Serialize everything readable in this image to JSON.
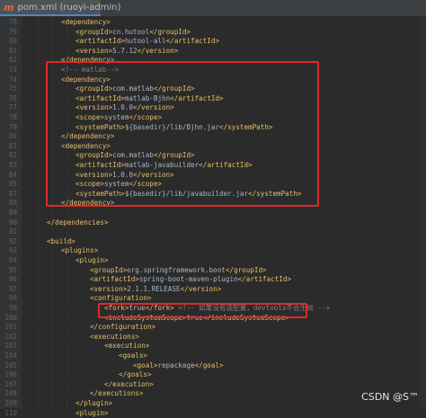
{
  "tab": {
    "icon": "m",
    "label": "pom.xml (ruoyi-admin)"
  },
  "colors": {
    "tag": "#e8bf6a",
    "comment": "#808080",
    "text": "#a9b7c6",
    "highlight": "#e02a2a"
  },
  "lines": [
    {
      "n": "78",
      "indent": 2,
      "parts": [
        [
          "t",
          "<dependency>"
        ]
      ]
    },
    {
      "n": "79",
      "indent": 3,
      "parts": [
        [
          "t",
          "<groupId>"
        ],
        [
          "x",
          "cn.hutool"
        ],
        [
          "t",
          "</groupId>"
        ]
      ]
    },
    {
      "n": "80",
      "indent": 3,
      "parts": [
        [
          "t",
          "<artifactId>"
        ],
        [
          "x",
          "hutool-all"
        ],
        [
          "t",
          "</artifactId>"
        ]
      ]
    },
    {
      "n": "81",
      "indent": 3,
      "parts": [
        [
          "t",
          "<version>"
        ],
        [
          "x",
          "5.7.12"
        ],
        [
          "t",
          "</version>"
        ]
      ]
    },
    {
      "n": "82",
      "indent": 2,
      "parts": [
        [
          "t",
          "</dependency>"
        ]
      ]
    },
    {
      "n": "73",
      "indent": 2,
      "parts": [
        [
          "c",
          "<!-- matlab-->"
        ]
      ]
    },
    {
      "n": "74",
      "indent": 2,
      "parts": [
        [
          "t",
          "<dependency>"
        ]
      ]
    },
    {
      "n": "75",
      "indent": 3,
      "parts": [
        [
          "t",
          "<groupId>"
        ],
        [
          "x",
          "com.matlab"
        ],
        [
          "t",
          "</groupId>"
        ]
      ]
    },
    {
      "n": "76",
      "indent": 3,
      "parts": [
        [
          "t",
          "<artifactId>"
        ],
        [
          "x",
          "matlab-Bjhn"
        ],
        [
          "t",
          "</artifactId>"
        ]
      ]
    },
    {
      "n": "77",
      "indent": 3,
      "parts": [
        [
          "t",
          "<version>"
        ],
        [
          "x",
          "1.0.0"
        ],
        [
          "t",
          "</version>"
        ]
      ]
    },
    {
      "n": "78",
      "indent": 3,
      "parts": [
        [
          "t",
          "<scope>"
        ],
        [
          "x",
          "system"
        ],
        [
          "t",
          "</scope>"
        ]
      ]
    },
    {
      "n": "79",
      "indent": 3,
      "parts": [
        [
          "t",
          "<systemPath>"
        ],
        [
          "x",
          "${basedir}/lib/Bjhn.jar"
        ],
        [
          "t",
          "</systemPath>"
        ]
      ]
    },
    {
      "n": "80",
      "indent": 2,
      "parts": [
        [
          "t",
          "</dependency>"
        ]
      ]
    },
    {
      "n": "81",
      "indent": 2,
      "parts": [
        [
          "t",
          "<dependency>"
        ]
      ]
    },
    {
      "n": "82",
      "indent": 3,
      "parts": [
        [
          "t",
          "<groupId>"
        ],
        [
          "x",
          "com.matlab"
        ],
        [
          "t",
          "</groupId>"
        ]
      ]
    },
    {
      "n": "83",
      "indent": 3,
      "parts": [
        [
          "t",
          "<artifactId>"
        ],
        [
          "x",
          "matlab-javabuilder"
        ],
        [
          "t",
          "</artifactId>"
        ]
      ]
    },
    {
      "n": "84",
      "indent": 3,
      "parts": [
        [
          "t",
          "<version>"
        ],
        [
          "x",
          "1.0.0"
        ],
        [
          "t",
          "</version>"
        ]
      ]
    },
    {
      "n": "85",
      "indent": 3,
      "parts": [
        [
          "t",
          "<scope>"
        ],
        [
          "x",
          "system"
        ],
        [
          "t",
          "</scope>"
        ]
      ]
    },
    {
      "n": "87",
      "indent": 3,
      "parts": [
        [
          "t",
          "<systemPath>"
        ],
        [
          "x",
          "${basedir}/lib/javabuilder.jar"
        ],
        [
          "t",
          "</systemPath>"
        ]
      ]
    },
    {
      "n": "88",
      "indent": 2,
      "parts": [
        [
          "t",
          "</dependency>"
        ]
      ]
    },
    {
      "n": "89",
      "indent": 2,
      "parts": []
    },
    {
      "n": "90",
      "indent": 1,
      "parts": [
        [
          "t",
          "</dependencies>"
        ]
      ]
    },
    {
      "n": "91",
      "indent": 0,
      "parts": []
    },
    {
      "n": "92",
      "indent": 1,
      "parts": [
        [
          "t",
          "<build>"
        ]
      ]
    },
    {
      "n": "93",
      "indent": 2,
      "parts": [
        [
          "t",
          "<plugins>"
        ]
      ]
    },
    {
      "n": "94",
      "indent": 3,
      "parts": [
        [
          "t",
          "<plugin>"
        ]
      ]
    },
    {
      "n": "95",
      "indent": 4,
      "parts": [
        [
          "t",
          "<groupId>"
        ],
        [
          "x",
          "org.springframework.boot"
        ],
        [
          "t",
          "</groupId>"
        ]
      ]
    },
    {
      "n": "96",
      "indent": 4,
      "parts": [
        [
          "t",
          "<artifactId>"
        ],
        [
          "x",
          "spring-boot-maven-plugin"
        ],
        [
          "t",
          "</artifactId>"
        ]
      ]
    },
    {
      "n": "97",
      "indent": 4,
      "parts": [
        [
          "t",
          "<version>"
        ],
        [
          "x",
          "2.1.1.RELEASE"
        ],
        [
          "t",
          "</version>"
        ]
      ]
    },
    {
      "n": "98",
      "indent": 4,
      "parts": [
        [
          "t",
          "<configuration>"
        ]
      ]
    },
    {
      "n": "99",
      "indent": 5,
      "parts": [
        [
          "t",
          "<fork>"
        ],
        [
          "x",
          "true"
        ],
        [
          "t",
          "</fork>"
        ],
        [
          "x",
          " "
        ],
        [
          "c",
          "<!-- 如果没有该配置，devtools不会生效 -->"
        ]
      ]
    },
    {
      "n": "100",
      "indent": 5,
      "parts": [
        [
          "t",
          "<includeSystemScope>"
        ],
        [
          "x",
          "true"
        ],
        [
          "t",
          "</includeSystemScope>"
        ]
      ]
    },
    {
      "n": "101",
      "indent": 4,
      "parts": [
        [
          "t",
          "</configuration>"
        ]
      ]
    },
    {
      "n": "102",
      "indent": 4,
      "parts": [
        [
          "t",
          "<executions>"
        ]
      ]
    },
    {
      "n": "103",
      "indent": 5,
      "parts": [
        [
          "t",
          "<execution>"
        ]
      ]
    },
    {
      "n": "104",
      "indent": 6,
      "parts": [
        [
          "t",
          "<goals>"
        ]
      ]
    },
    {
      "n": "105",
      "indent": 7,
      "parts": [
        [
          "t",
          "<goal>"
        ],
        [
          "x",
          "repackage"
        ],
        [
          "t",
          "</goal>"
        ]
      ]
    },
    {
      "n": "106",
      "indent": 6,
      "parts": [
        [
          "t",
          "</goals>"
        ]
      ]
    },
    {
      "n": "107",
      "indent": 5,
      "parts": [
        [
          "t",
          "</execution>"
        ]
      ]
    },
    {
      "n": "108",
      "indent": 4,
      "parts": [
        [
          "t",
          "</executions>"
        ]
      ]
    },
    {
      "n": "109",
      "indent": 3,
      "parts": [
        [
          "t",
          "</plugin>"
        ]
      ]
    },
    {
      "n": "110",
      "indent": 3,
      "parts": [
        [
          "t",
          "<plugin>"
        ]
      ]
    }
  ],
  "watermark": "CSDN @S™"
}
